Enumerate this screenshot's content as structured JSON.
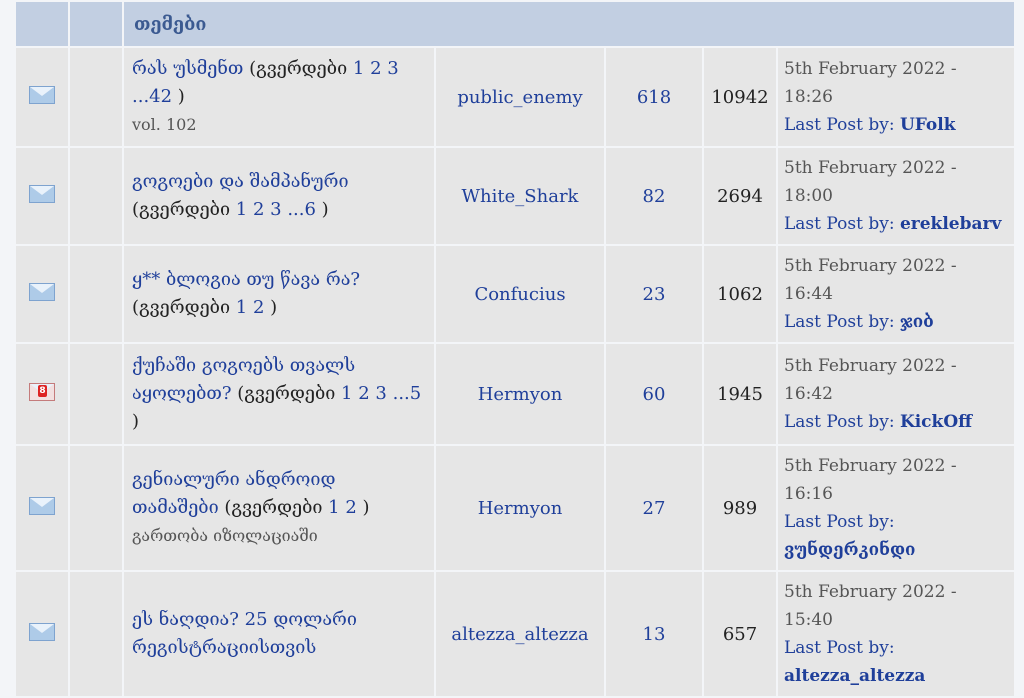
{
  "header": {
    "topics": "თემები"
  },
  "rows": [
    {
      "title": "რას უსმენთ",
      "pages_prefix": " (გვერდები ",
      "pages": [
        "1",
        "2",
        "3"
      ],
      "last_page": "...42",
      "pages_suffix": " )",
      "desc": "vol. 102",
      "author": "public_enemy",
      "replies": "618",
      "views": "10942",
      "date": "5th February 2022 - 18:26",
      "last_label": "Last Post by: ",
      "last_poster": "UFolk",
      "icon": "envelope-icon"
    },
    {
      "title": "გოგოები და შამპანური",
      "pages_prefix": " (გვერდები ",
      "pages": [
        "1",
        "2",
        "3"
      ],
      "last_page": "...6",
      "pages_suffix": " )",
      "desc": "",
      "author": "White_Shark",
      "replies": "82",
      "views": "2694",
      "date": "5th February 2022 - 18:00",
      "last_label": "Last Post by: ",
      "last_poster": "ereklebarv",
      "icon": "envelope-icon"
    },
    {
      "title": "ყ** ბლოგია თუ წავა რა?",
      "pages_prefix": " (გვერდები ",
      "pages": [
        "1",
        "2"
      ],
      "last_page": "",
      "pages_suffix": " )",
      "desc": "",
      "author": "Confucius",
      "replies": "23",
      "views": "1062",
      "date": "5th February 2022 - 16:44",
      "last_label": "Last Post by: ",
      "last_poster": "ჯიბ",
      "icon": "envelope-icon"
    },
    {
      "title": "ქუჩაში გოგოებს თვალს აყოლებთ?",
      "pages_prefix": " (გვერდები ",
      "pages": [
        "1",
        "2",
        "3"
      ],
      "last_page": "...5",
      "pages_suffix": " )",
      "desc": "",
      "author": "Hermyon",
      "replies": "60",
      "views": "1945",
      "date": "5th February 2022 - 16:42",
      "last_label": "Last Post by: ",
      "last_poster": "KickOff",
      "icon": "hot-topic-envelope-icon"
    },
    {
      "title": "გენიალური ანდროიდ თამაშები",
      "pages_prefix": " (გვერდები ",
      "pages": [
        "1",
        "2"
      ],
      "last_page": "",
      "pages_suffix": " )",
      "desc": "გართობა იზოლაციაში",
      "author": "Hermyon",
      "replies": "27",
      "views": "989",
      "date": "5th February 2022 - 16:16",
      "last_label": "Last Post by: ",
      "last_poster": "ვუნდერკინდი",
      "icon": "envelope-icon"
    },
    {
      "title": "ეს ნაღდია? 25 დოლარი რეგისტრაციისთვის",
      "pages_prefix": "",
      "pages": [],
      "last_page": "",
      "pages_suffix": "",
      "desc": "",
      "author": "altezza_altezza",
      "replies": "13",
      "views": "657",
      "date": "5th February 2022 - 15:40",
      "last_label": "Last Post by: ",
      "last_poster": "altezza_altezza",
      "icon": "envelope-icon"
    }
  ]
}
